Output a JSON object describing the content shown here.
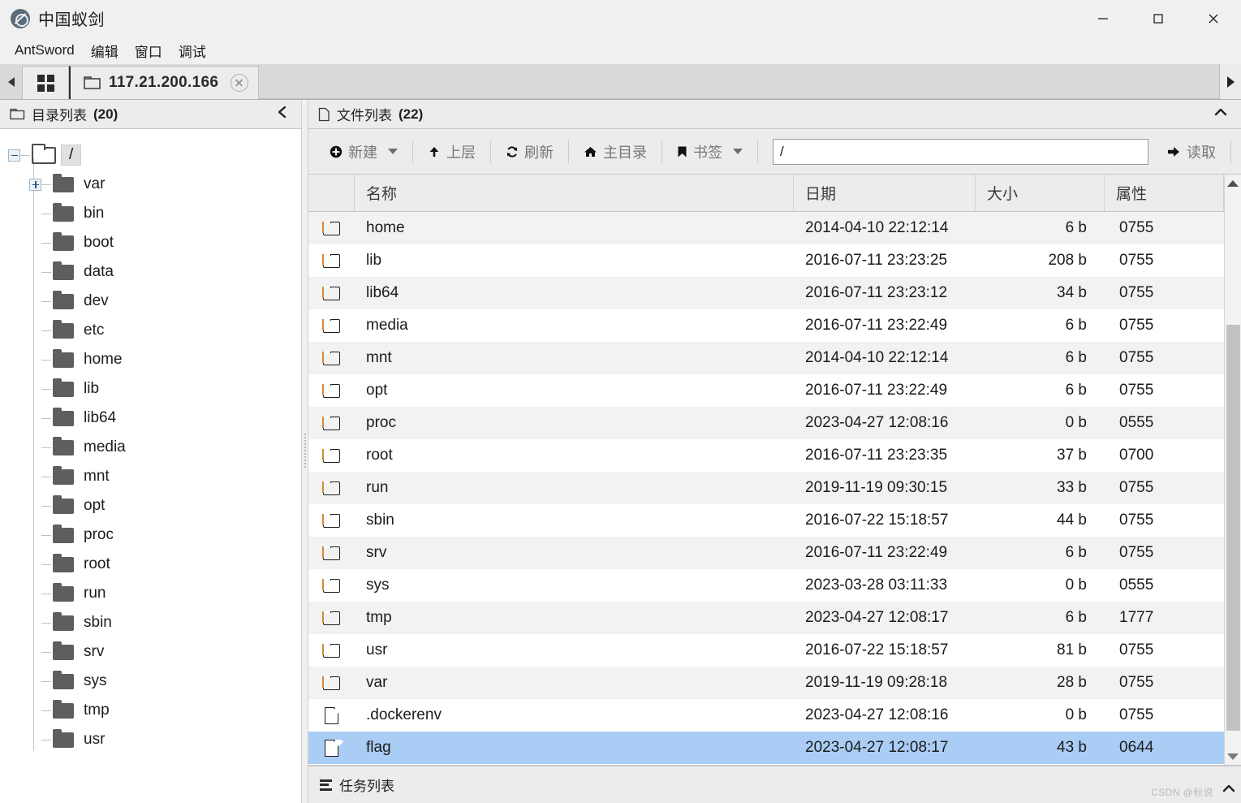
{
  "window": {
    "title": "中国蚁剑",
    "logo_icon": "antsword-logo-icon",
    "minimize_label": "—",
    "maximize_label": "□",
    "close_label": "✕"
  },
  "menubar": {
    "items": [
      {
        "label": "AntSword"
      },
      {
        "label": "编辑"
      },
      {
        "label": "窗口"
      },
      {
        "label": "调试"
      }
    ]
  },
  "tabbar": {
    "scroll_left_icon": "triangle-left-icon",
    "scroll_right_icon": "triangle-right-icon",
    "home_tab_icon": "grid-icon",
    "tabs": [
      {
        "label": "117.21.200.166",
        "icon": "folder-outline-icon",
        "close_icon": "close-circle-icon",
        "active": true
      }
    ]
  },
  "sidebar": {
    "header": {
      "icon": "folder-outline-icon",
      "title": "目录列表",
      "count": "(20)",
      "collapse_icon": "chevron-left-icon"
    },
    "root": {
      "expander": "minus",
      "label": "/",
      "icon": "folder-open-icon",
      "selected": true
    },
    "items": [
      {
        "label": "var",
        "icon": "folder-icon",
        "expander": "plus"
      },
      {
        "label": "bin",
        "icon": "folder-icon",
        "expander": "none"
      },
      {
        "label": "boot",
        "icon": "folder-icon",
        "expander": "none"
      },
      {
        "label": "data",
        "icon": "folder-icon",
        "expander": "none"
      },
      {
        "label": "dev",
        "icon": "folder-icon",
        "expander": "none"
      },
      {
        "label": "etc",
        "icon": "folder-icon",
        "expander": "none"
      },
      {
        "label": "home",
        "icon": "folder-icon",
        "expander": "none"
      },
      {
        "label": "lib",
        "icon": "folder-icon",
        "expander": "none"
      },
      {
        "label": "lib64",
        "icon": "folder-icon",
        "expander": "none"
      },
      {
        "label": "media",
        "icon": "folder-icon",
        "expander": "none"
      },
      {
        "label": "mnt",
        "icon": "folder-icon",
        "expander": "none"
      },
      {
        "label": "opt",
        "icon": "folder-icon",
        "expander": "none"
      },
      {
        "label": "proc",
        "icon": "folder-icon",
        "expander": "none"
      },
      {
        "label": "root",
        "icon": "folder-icon",
        "expander": "none"
      },
      {
        "label": "run",
        "icon": "folder-icon",
        "expander": "none"
      },
      {
        "label": "sbin",
        "icon": "folder-icon",
        "expander": "none"
      },
      {
        "label": "srv",
        "icon": "folder-icon",
        "expander": "none"
      },
      {
        "label": "sys",
        "icon": "folder-icon",
        "expander": "none"
      },
      {
        "label": "tmp",
        "icon": "folder-icon",
        "expander": "none"
      },
      {
        "label": "usr",
        "icon": "folder-icon",
        "expander": "none"
      }
    ]
  },
  "main": {
    "header": {
      "icon": "file-outline-icon",
      "title": "文件列表",
      "count": "(22)",
      "collapse_icon": "chevron-up-icon"
    },
    "toolbar": {
      "new_label": "新建",
      "new_icon": "plus-circle-icon",
      "up_label": "上层",
      "up_icon": "arrow-up-icon",
      "refresh_label": "刷新",
      "refresh_icon": "refresh-icon",
      "home_label": "主目录",
      "home_icon": "home-icon",
      "bookmark_label": "书签",
      "bookmark_icon": "bookmark-icon",
      "read_label": "读取",
      "read_icon": "arrow-right-icon",
      "path_value": "/",
      "path_placeholder": "/"
    },
    "table": {
      "columns": [
        "",
        "名称",
        "日期",
        "大小",
        "属性"
      ],
      "rows": [
        {
          "icon": "folder-icon",
          "name": "home",
          "date": "2014-04-10 22:12:14",
          "size": "6 b",
          "attr": "0755",
          "selected": false
        },
        {
          "icon": "folder-icon",
          "name": "lib",
          "date": "2016-07-11 23:23:25",
          "size": "208 b",
          "attr": "0755",
          "selected": false
        },
        {
          "icon": "folder-icon",
          "name": "lib64",
          "date": "2016-07-11 23:23:12",
          "size": "34 b",
          "attr": "0755",
          "selected": false
        },
        {
          "icon": "folder-icon",
          "name": "media",
          "date": "2016-07-11 23:22:49",
          "size": "6 b",
          "attr": "0755",
          "selected": false
        },
        {
          "icon": "folder-icon",
          "name": "mnt",
          "date": "2014-04-10 22:12:14",
          "size": "6 b",
          "attr": "0755",
          "selected": false
        },
        {
          "icon": "folder-icon",
          "name": "opt",
          "date": "2016-07-11 23:22:49",
          "size": "6 b",
          "attr": "0755",
          "selected": false
        },
        {
          "icon": "folder-icon",
          "name": "proc",
          "date": "2023-04-27 12:08:16",
          "size": "0 b",
          "attr": "0555",
          "selected": false
        },
        {
          "icon": "folder-icon",
          "name": "root",
          "date": "2016-07-11 23:23:35",
          "size": "37 b",
          "attr": "0700",
          "selected": false
        },
        {
          "icon": "folder-icon",
          "name": "run",
          "date": "2019-11-19 09:30:15",
          "size": "33 b",
          "attr": "0755",
          "selected": false
        },
        {
          "icon": "folder-icon",
          "name": "sbin",
          "date": "2016-07-22 15:18:57",
          "size": "44 b",
          "attr": "0755",
          "selected": false
        },
        {
          "icon": "folder-icon",
          "name": "srv",
          "date": "2016-07-11 23:22:49",
          "size": "6 b",
          "attr": "0755",
          "selected": false
        },
        {
          "icon": "folder-icon",
          "name": "sys",
          "date": "2023-03-28 03:11:33",
          "size": "0 b",
          "attr": "0555",
          "selected": false
        },
        {
          "icon": "folder-icon",
          "name": "tmp",
          "date": "2023-04-27 12:08:17",
          "size": "6 b",
          "attr": "1777",
          "selected": false
        },
        {
          "icon": "folder-icon",
          "name": "usr",
          "date": "2016-07-22 15:18:57",
          "size": "81 b",
          "attr": "0755",
          "selected": false
        },
        {
          "icon": "folder-icon",
          "name": "var",
          "date": "2019-11-19 09:28:18",
          "size": "28 b",
          "attr": "0755",
          "selected": false
        },
        {
          "icon": "file-icon",
          "name": ".dockerenv",
          "date": "2023-04-27 12:08:16",
          "size": "0 b",
          "attr": "0755",
          "selected": false
        },
        {
          "icon": "file-icon",
          "name": "flag",
          "date": "2023-04-27 12:08:17",
          "size": "43 b",
          "attr": "0644",
          "selected": true
        }
      ]
    },
    "scrollbar": {
      "up_icon": "triangle-up-icon",
      "down_icon": "triangle-down-icon",
      "thumb_top_pct": 24,
      "thumb_height_pct": 73
    }
  },
  "bottombar": {
    "icon": "list-icon",
    "title": "任务列表",
    "collapse_icon": "chevron-up-icon",
    "watermark": "CSDN @秋说"
  }
}
